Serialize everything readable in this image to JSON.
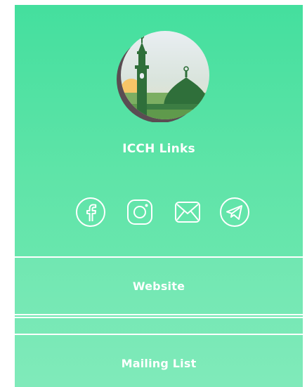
{
  "profile": {
    "title": "ICCH Links",
    "avatar_icon": "mosque-icon"
  },
  "social": [
    {
      "name": "facebook",
      "icon": "facebook-icon"
    },
    {
      "name": "instagram",
      "icon": "instagram-icon"
    },
    {
      "name": "email",
      "icon": "email-icon"
    },
    {
      "name": "telegram",
      "icon": "telegram-icon"
    }
  ],
  "links": [
    {
      "label": "Website"
    },
    {
      "label": ""
    },
    {
      "label": "Mailing List"
    }
  ],
  "colors": {
    "background_top": "#44df9e",
    "background_bottom": "#78e9b6",
    "text": "#ffffff"
  }
}
